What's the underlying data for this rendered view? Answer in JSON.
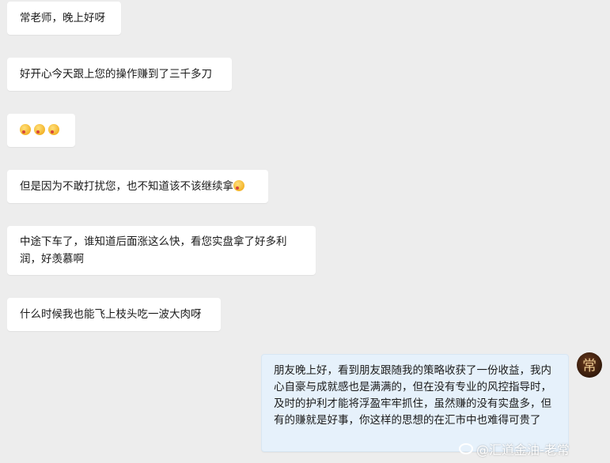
{
  "messages": [
    {
      "text": "常老师，晚上好呀"
    },
    {
      "text": "好开心今天跟上您的操作赚到了三千多刀"
    },
    {
      "text": "",
      "emoji_count": 3,
      "icon": "smirk-face-emoji"
    },
    {
      "text": "但是因为不敢打扰您，也不知道该不该继续拿",
      "icon": "laugh-cry-emoji"
    },
    {
      "text": "中途下车了，谁知道后面涨这么快，看您实盘拿了好多利润，好羡慕啊"
    },
    {
      "text": "什么时候我也能飞上枝头吃一波大肉呀"
    },
    {
      "text": "朋友晚上好，看到朋友跟随我的策略收获了一份收益，我内心自豪与成就感也是满满的，但在没有专业的风控指导时，及时的护利才能将浮盈牢牢抓住，虽然赚的没有实盘多，但有的赚就是好事，你这样的思想的在汇市中也难得可贵了"
    }
  ],
  "avatar_char": "常",
  "watermark": "@汇道金油-老常",
  "colors": {
    "background": "#ededed",
    "bubble_in": "#ffffff",
    "bubble_out": "#e6f1fb"
  }
}
